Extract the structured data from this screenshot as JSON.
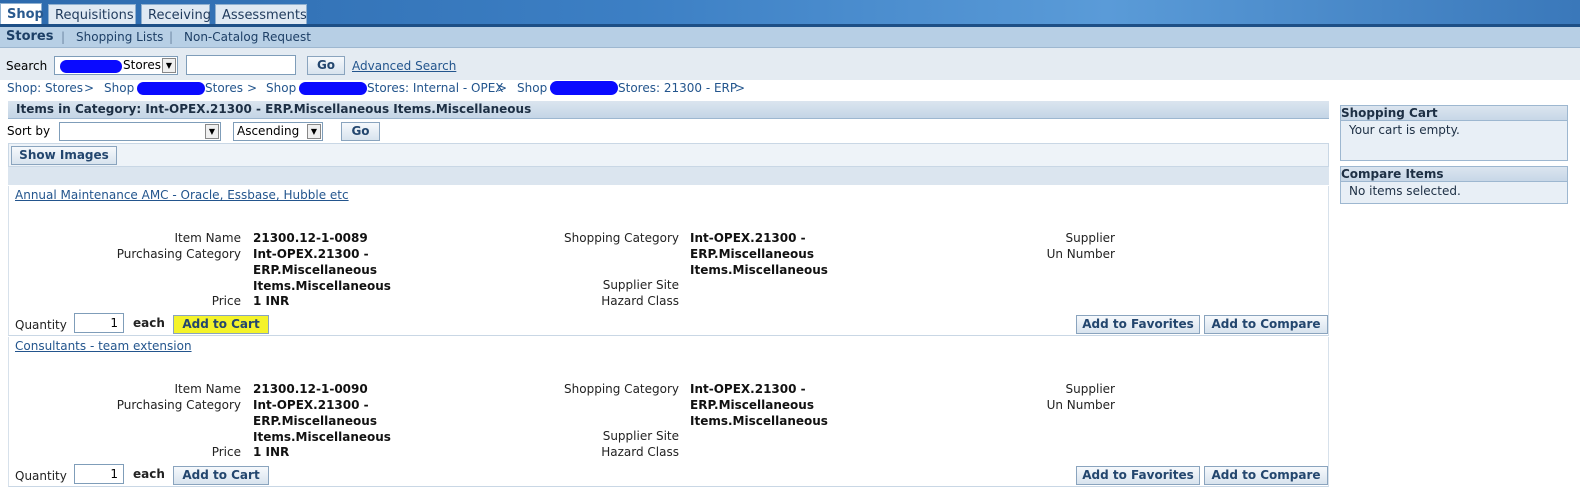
{
  "tabs": [
    "Shop",
    "Requisitions",
    "Receiving",
    "Assessments"
  ],
  "subnav": [
    "Stores",
    "Shopping Lists",
    "Non-Catalog Request"
  ],
  "search": {
    "label": "Search",
    "store_value": "Stores",
    "input_value": "",
    "go": "Go",
    "advanced": "Advanced Search"
  },
  "breadcrumbs": [
    "Shop: Stores",
    ">",
    "Shop",
    "Stores",
    ">",
    "Shop",
    "Stores: Internal - OPEX",
    ">",
    "Shop",
    "Stores: 21300 - ERP",
    ">"
  ],
  "section": {
    "title": "Items in Category: Int-OPEX.21300 - ERP.Miscellaneous Items.Miscellaneous",
    "sort_label": "Sort by",
    "sort_value": "",
    "order_value": "Ascending",
    "go": "Go",
    "show_images": "Show Images"
  },
  "labels": {
    "item_name": "Item Name",
    "purchasing_category": "Purchasing Category",
    "price": "Price",
    "shopping_category": "Shopping Category",
    "supplier_site": "Supplier Site",
    "hazard_class": "Hazard Class",
    "supplier": "Supplier",
    "un_number": "Un Number",
    "quantity": "Quantity",
    "each": "each",
    "add_to_cart": "Add to Cart",
    "add_to_favorites": "Add to Favorites",
    "add_to_compare": "Add to Compare"
  },
  "items": [
    {
      "title": "Annual Maintenance AMC - Oracle, Essbase, Hubble etc",
      "item_name": "21300.12-1-0089",
      "purchasing_category": [
        "Int-OPEX.21300 -",
        "ERP.Miscellaneous",
        "Items.Miscellaneous"
      ],
      "price": "1  INR",
      "shopping_category": [
        "Int-OPEX.21300 -",
        "ERP.Miscellaneous",
        "Items.Miscellaneous"
      ],
      "quantity": "1",
      "highlight_color": "#f4f32a"
    },
    {
      "title": "Consultants - team extension",
      "item_name": "21300.12-1-0090",
      "purchasing_category": [
        "Int-OPEX.21300 -",
        "ERP.Miscellaneous",
        "Items.Miscellaneous"
      ],
      "price": "1  INR",
      "shopping_category": [
        "Int-OPEX.21300 -",
        "ERP.Miscellaneous",
        "Items.Miscellaneous"
      ],
      "quantity": "1"
    }
  ],
  "shopping_cart": {
    "title": "Shopping Cart",
    "empty": "Your cart is empty."
  },
  "compare_items": {
    "title": "Compare Items",
    "empty": "No items selected."
  },
  "colors": {
    "accent": "#2d6aad",
    "link": "#23558d",
    "redaction": "#0a0aff",
    "highlight": "#f4f32a"
  }
}
